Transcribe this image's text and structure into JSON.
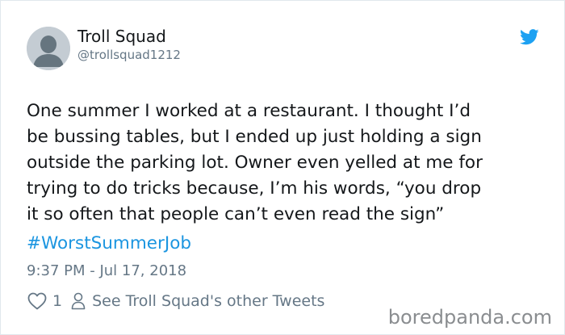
{
  "tweet": {
    "author": {
      "display_name": "Troll Squad",
      "handle": "@trollsquad1212",
      "avatar_icon": "default-avatar-icon"
    },
    "brand_icon": "twitter-bird-icon",
    "text": "One summer I worked at a restaurant. I thought I’d\nbe bussing tables, but I ended up just holding a sign\noutside the parking lot. Owner even yelled at me for\ntrying to do tricks because, I’m his words, “you drop\nit so often that people can’t even read the sign”",
    "hashtag": "#WorstSummerJob",
    "timestamp": "9:37 PM - Jul 17, 2018",
    "actions": {
      "like_icon": "heart-icon",
      "like_count": "1",
      "profile_icon": "person-icon",
      "other_tweets_label": "See Troll Squad's other Tweets"
    }
  },
  "watermark": "boredpanda.com",
  "colors": {
    "text": "#14171a",
    "muted": "#657786",
    "link": "#1b95e0",
    "brand": "#1da1f2",
    "border": "#e1e8ed"
  }
}
